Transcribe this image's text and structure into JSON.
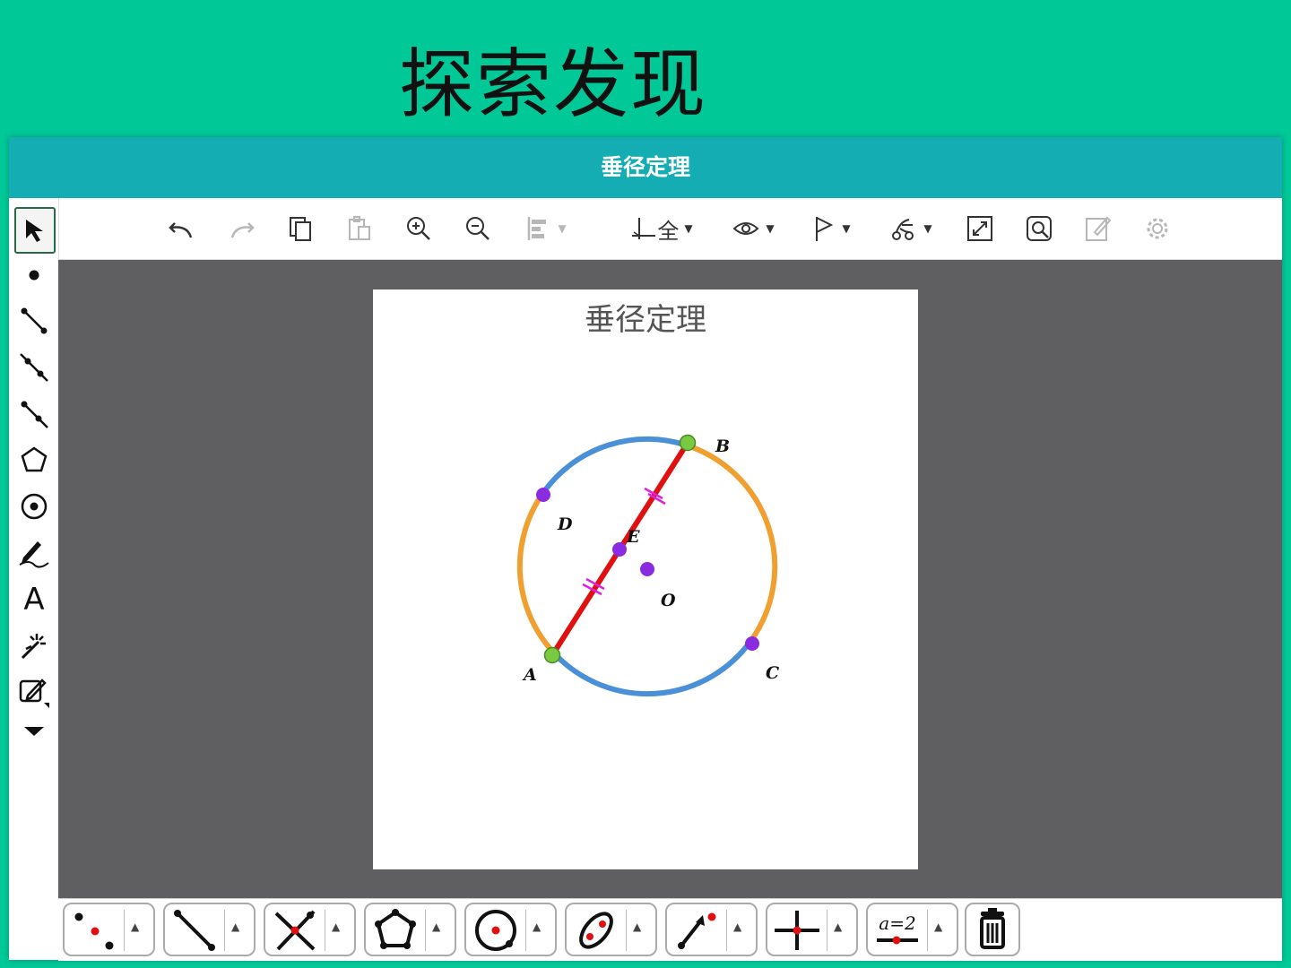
{
  "slide": {
    "title": "探索发现"
  },
  "window": {
    "title": "垂径定理"
  },
  "toolbar": {
    "items": [
      {
        "name": "undo-icon",
        "enabled": true
      },
      {
        "name": "redo-icon",
        "enabled": false
      },
      {
        "name": "copy-icon",
        "enabled": true
      },
      {
        "name": "paste-icon",
        "enabled": false
      },
      {
        "name": "zoom-in-icon",
        "enabled": true
      },
      {
        "name": "zoom-out-icon",
        "enabled": true
      },
      {
        "name": "align-icon",
        "enabled": false
      },
      {
        "name": "axes-grid-icon",
        "enabled": true
      },
      {
        "name": "eye-icon",
        "enabled": true
      },
      {
        "name": "flag-icon",
        "enabled": true
      },
      {
        "name": "animation-icon",
        "enabled": true
      },
      {
        "name": "fullscreen-icon",
        "enabled": true
      },
      {
        "name": "search-icon",
        "enabled": true
      },
      {
        "name": "edit-icon",
        "enabled": false
      },
      {
        "name": "settings-icon",
        "enabled": false
      }
    ],
    "axes_label": "全"
  },
  "left_tools": [
    "select-arrow-icon",
    "point-icon",
    "segment-icon",
    "line-icon",
    "ray-icon",
    "polygon-icon",
    "circle-icon",
    "pen-icon",
    "text-icon",
    "magic-icon",
    "edit-tool-icon",
    "more-icon"
  ],
  "left_tools_text": "A",
  "drawing": {
    "title": "垂径定理",
    "points": {
      "A": "A",
      "B": "B",
      "C": "C",
      "D": "D",
      "E": "E",
      "O": "O"
    },
    "colors": {
      "arc_blue": "#4a90d9",
      "arc_orange": "#f0a030",
      "chord": "#e01010",
      "endpoint": "#7ac943",
      "point": "#8a2be2",
      "tick": "#e020e0"
    }
  },
  "bottom_tools": [
    "point-tool-icon",
    "segment-tool-icon",
    "intersect-tool-icon",
    "polygon-tool-icon",
    "circle-tool-icon",
    "conic-tool-icon",
    "vector-tool-icon",
    "perpendicular-tool-icon",
    "slider-tool-icon"
  ],
  "slider_label": "a=2"
}
